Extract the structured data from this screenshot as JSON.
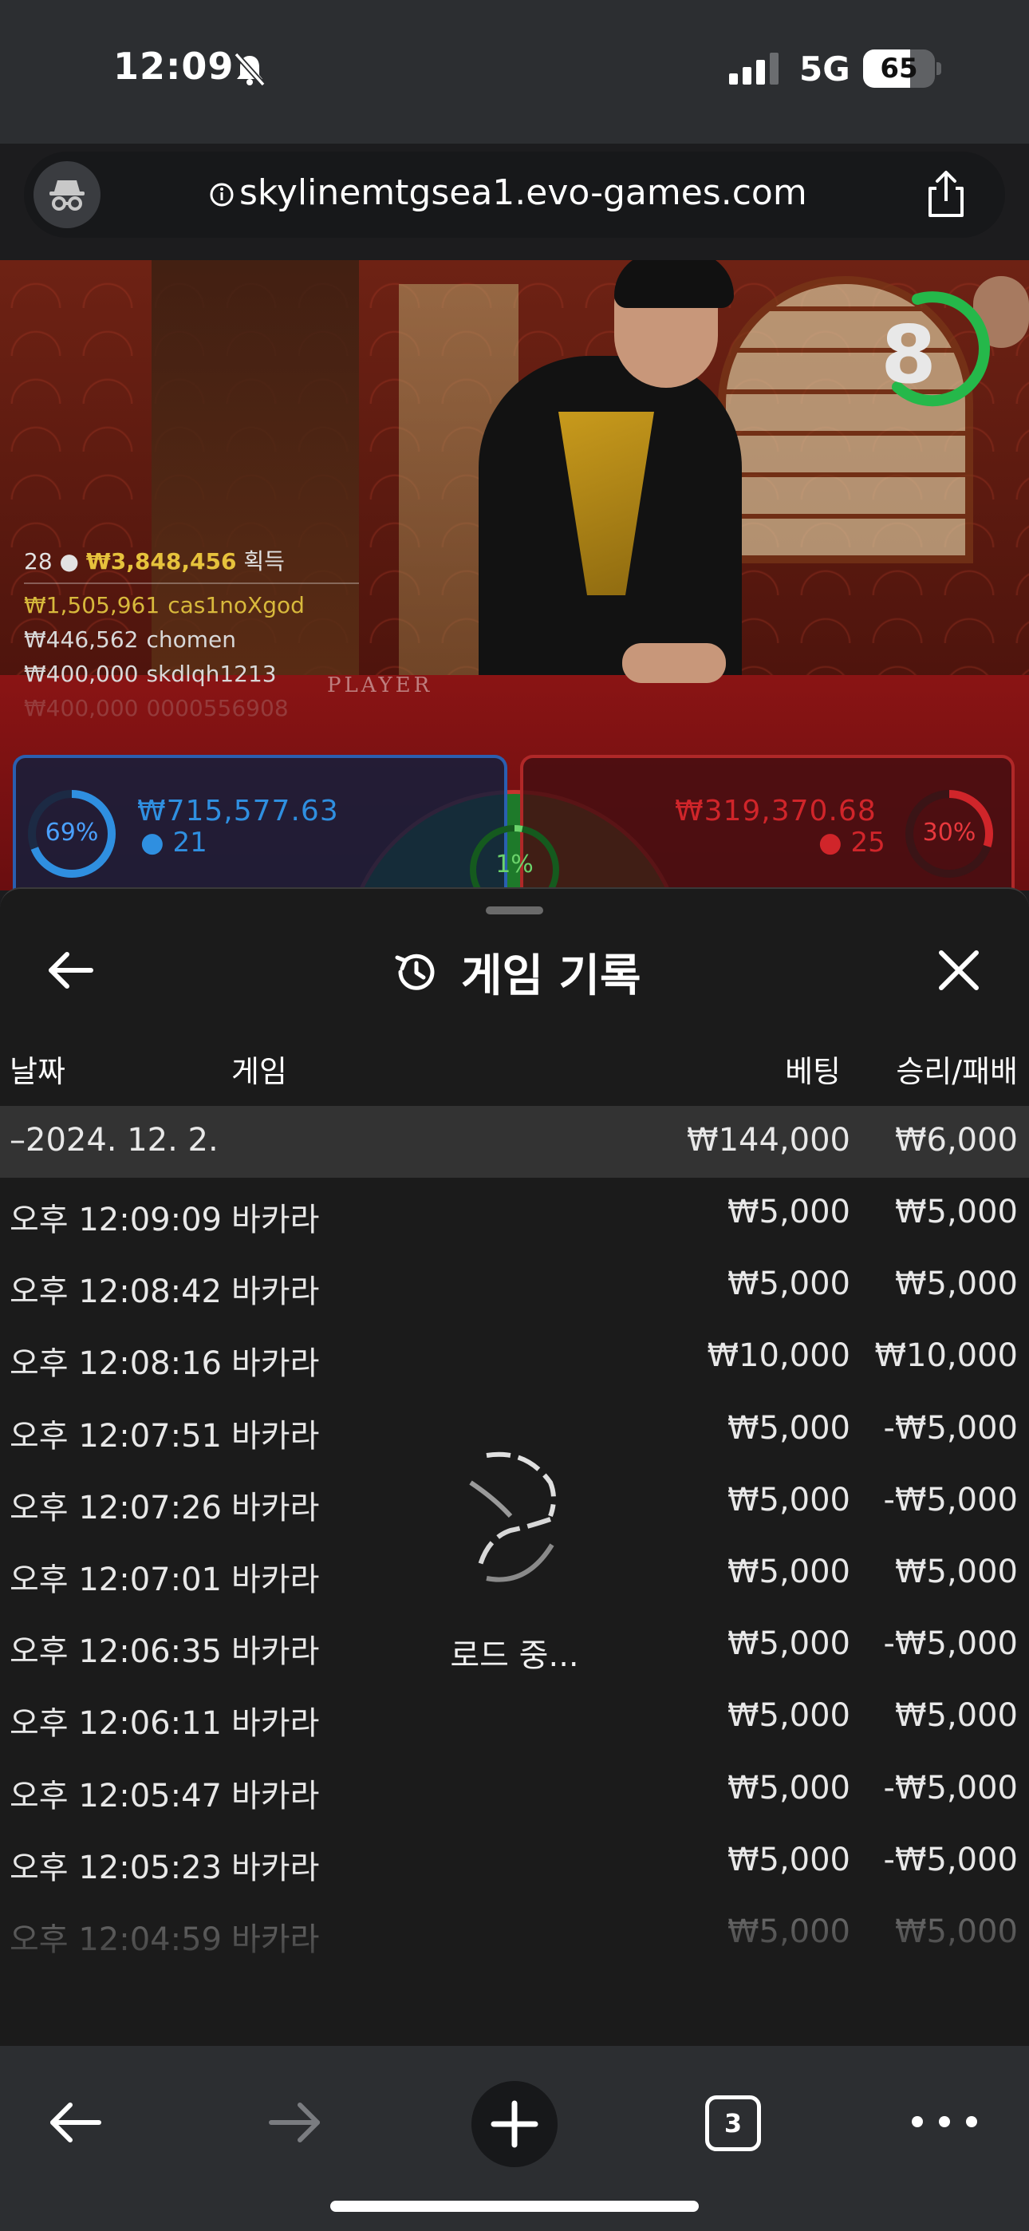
{
  "status_bar": {
    "time": "12:09",
    "network": "5G",
    "battery": "65",
    "battery_level": 0.65
  },
  "address_bar": {
    "url": "skylinemtgsea1.evo-games.com"
  },
  "game": {
    "table_label": "PLAYER",
    "timer": "8",
    "winners_header": {
      "count": "28",
      "total": "₩3,848,456",
      "suffix": "획득"
    },
    "winners": [
      {
        "amount": "₩1,505,961",
        "name": "cas1noXgod"
      },
      {
        "amount": "₩446,562",
        "name": "chomen"
      },
      {
        "amount": "₩400,000",
        "name": "skdlqh1213"
      },
      {
        "amount": "₩400,000",
        "name": "0000556908"
      }
    ],
    "player": {
      "percent": "69%",
      "percent_value": 69,
      "amount": "₩715,577.63",
      "count": "21"
    },
    "banker": {
      "percent": "30%",
      "percent_value": 30,
      "amount": "₩319,370.68",
      "count": "25"
    },
    "tie": {
      "percent": "1%",
      "percent_value": 1
    }
  },
  "history": {
    "title": "게임 기록",
    "columns": {
      "date": "날짜",
      "game": "게임",
      "bet": "베팅",
      "result": "승리/패배"
    },
    "group": {
      "date": "–2024. 12. 2.",
      "bet": "₩144,000",
      "result": "₩6,000"
    },
    "rows": [
      {
        "time": "오후 12:09:09",
        "game": "바카라",
        "bet": "₩5,000",
        "result": "₩5,000"
      },
      {
        "time": "오후 12:08:42",
        "game": "바카라",
        "bet": "₩5,000",
        "result": "₩5,000"
      },
      {
        "time": "오후 12:08:16",
        "game": "바카라",
        "bet": "₩10,000",
        "result": "₩10,000"
      },
      {
        "time": "오후 12:07:51",
        "game": "바카라",
        "bet": "₩5,000",
        "result": "-₩5,000"
      },
      {
        "time": "오후 12:07:26",
        "game": "바카라",
        "bet": "₩5,000",
        "result": "-₩5,000"
      },
      {
        "time": "오후 12:07:01",
        "game": "바카라",
        "bet": "₩5,000",
        "result": "₩5,000"
      },
      {
        "time": "오후 12:06:35",
        "game": "바카라",
        "bet": "₩5,000",
        "result": "-₩5,000"
      },
      {
        "time": "오후 12:06:11",
        "game": "바카라",
        "bet": "₩5,000",
        "result": "₩5,000"
      },
      {
        "time": "오후 12:05:47",
        "game": "바카라",
        "bet": "₩5,000",
        "result": "-₩5,000"
      },
      {
        "time": "오후 12:05:23",
        "game": "바카라",
        "bet": "₩5,000",
        "result": "-₩5,000"
      },
      {
        "time": "오후 12:04:59",
        "game": "바카라",
        "bet": "₩5,000",
        "result": "₩5,000"
      }
    ],
    "loading_text": "로드 중..."
  },
  "toolbar": {
    "tab_count": "3"
  },
  "colors": {
    "player_blue": "#2f8fe0",
    "banker_red": "#d0252a",
    "tie_green": "#3fbf4a",
    "gold": "#e6c23c"
  }
}
